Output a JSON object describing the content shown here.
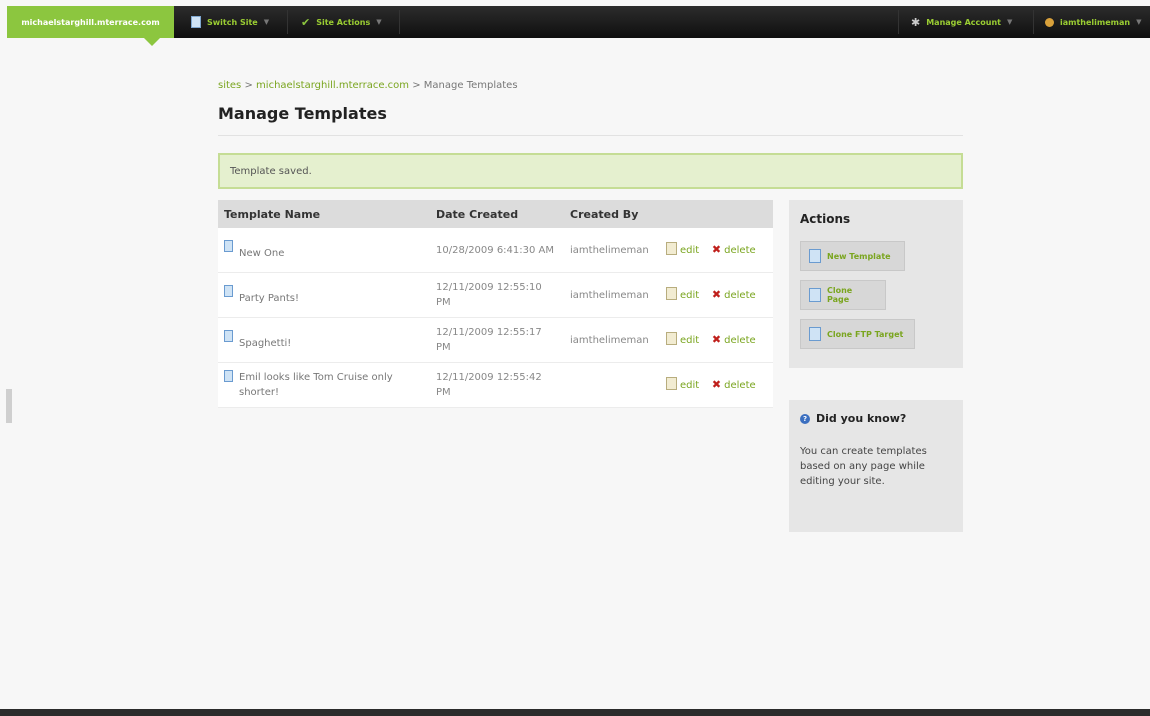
{
  "topbar": {
    "site": "michaelstarghill.mterrace.com",
    "switch_site": "Switch Site",
    "site_actions": "Site Actions",
    "manage_account": "Manage Account",
    "user": "iamthelimeman"
  },
  "breadcrumb": {
    "sites": "sites",
    "separator": ">",
    "site": "michaelstarghill.mterrace.com",
    "current": "Manage Templates"
  },
  "page": {
    "title": "Manage Templates",
    "flash": "Template saved."
  },
  "table": {
    "headers": [
      "Template Name",
      "Date Created",
      "Created By"
    ],
    "rows": [
      {
        "name": "New One",
        "date": "10/28/2009 6:41:30 AM",
        "by": "iamthelimeman",
        "edit": "edit",
        "delete": "delete"
      },
      {
        "name": "Party Pants!",
        "date": "12/11/2009 12:55:10 PM",
        "by": "iamthelimeman",
        "edit": "edit",
        "delete": "delete"
      },
      {
        "name": "Spaghetti!",
        "date": "12/11/2009 12:55:17 PM",
        "by": "iamthelimeman",
        "edit": "edit",
        "delete": "delete"
      },
      {
        "name": "Emil looks like Tom Cruise only shorter!",
        "date": "12/11/2009 12:55:42 PM",
        "by": "",
        "edit": "edit",
        "delete": "delete"
      }
    ]
  },
  "actions": {
    "title": "Actions",
    "new_template": "New Template",
    "clone_page": "Clone Page",
    "clone_ftp": "Clone FTP Target"
  },
  "tip": {
    "title": "Did you know?",
    "body": "You can create templates based on any page while editing your site."
  },
  "colors": {
    "accent": "#8cc63f",
    "link": "#7aa51f",
    "delete": "#c0201c",
    "flash_bg": "#e5f0cf"
  }
}
